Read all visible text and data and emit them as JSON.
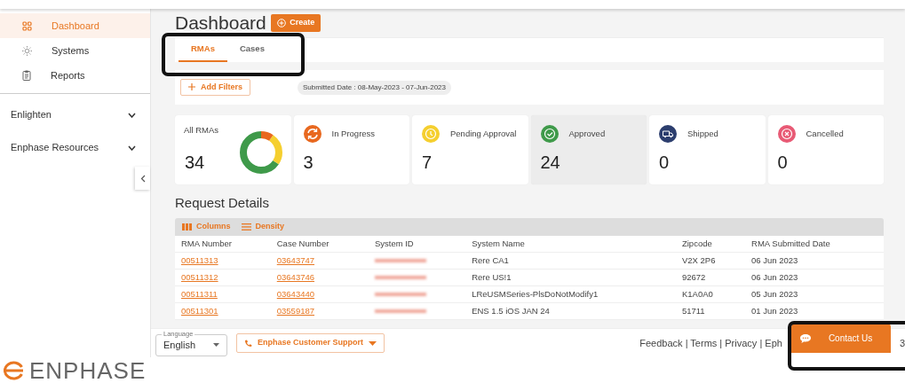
{
  "sidebar": {
    "items": [
      {
        "label": "Dashboard",
        "selected": true
      },
      {
        "label": "Systems",
        "selected": false
      },
      {
        "label": "Reports",
        "selected": false
      }
    ],
    "groups": [
      {
        "label": "Enlighten",
        "expanded": false
      },
      {
        "label": "Enphase Resources",
        "expanded": false
      }
    ]
  },
  "header": {
    "title": "Dashboard",
    "create_button": "Create"
  },
  "tabs": [
    {
      "label": "RMAs",
      "selected": true
    },
    {
      "label": "Cases",
      "selected": false
    }
  ],
  "filters": {
    "add_button": "Add Filters",
    "chip": "Submitted Date : 08-May-2023 - 07-Jun-2023"
  },
  "cards": [
    {
      "kind": "donut",
      "label": "All RMAs",
      "count": "34",
      "selected": false
    },
    {
      "kind": "progress",
      "label": "In Progress",
      "count": "3",
      "color": "#e8681f",
      "selected": false
    },
    {
      "kind": "clock",
      "label": "Pending Approval",
      "count": "7",
      "color": "#f5cf2f",
      "selected": false
    },
    {
      "kind": "check",
      "label": "Approved",
      "count": "24",
      "color": "#3f9a4a",
      "selected": true
    },
    {
      "kind": "truck",
      "label": "Shipped",
      "count": "0",
      "color": "#2c3e6e",
      "selected": false
    },
    {
      "kind": "cancel",
      "label": "Cancelled",
      "count": "0",
      "color": "#e85a75",
      "selected": false
    }
  ],
  "table": {
    "title": "Request Details",
    "toolbar": [
      "Columns",
      "Density"
    ],
    "columns": [
      "RMA Number",
      "Case Number",
      "System ID",
      "System Name",
      "Zipcode",
      "RMA Submitted Date"
    ],
    "rows": [
      [
        "00511313",
        "03643747",
        "",
        "Rere CA1",
        "V2X 2P6",
        "06 Jun 2023"
      ],
      [
        "00511312",
        "03643746",
        "",
        "Rere US!1",
        "92672",
        "06 Jun 2023"
      ],
      [
        "00511311",
        "03643440",
        "",
        "LReUSMSeries-PlsDoNotModify1",
        "K1A0A0",
        "05 Jun 2023"
      ],
      [
        "00511301",
        "03559187",
        "",
        "ENS 1.5 iOS JAN 24",
        "51711",
        "01 Jun 2023"
      ]
    ]
  },
  "footer": {
    "language_label": "Language",
    "language": "English",
    "support_button": "Enphase Customer Support",
    "links": "Feedback | Terms | Privacy | Eph",
    "contact_button": "Contact Us",
    "trailing": "3"
  },
  "logo": "ENPHASE"
}
